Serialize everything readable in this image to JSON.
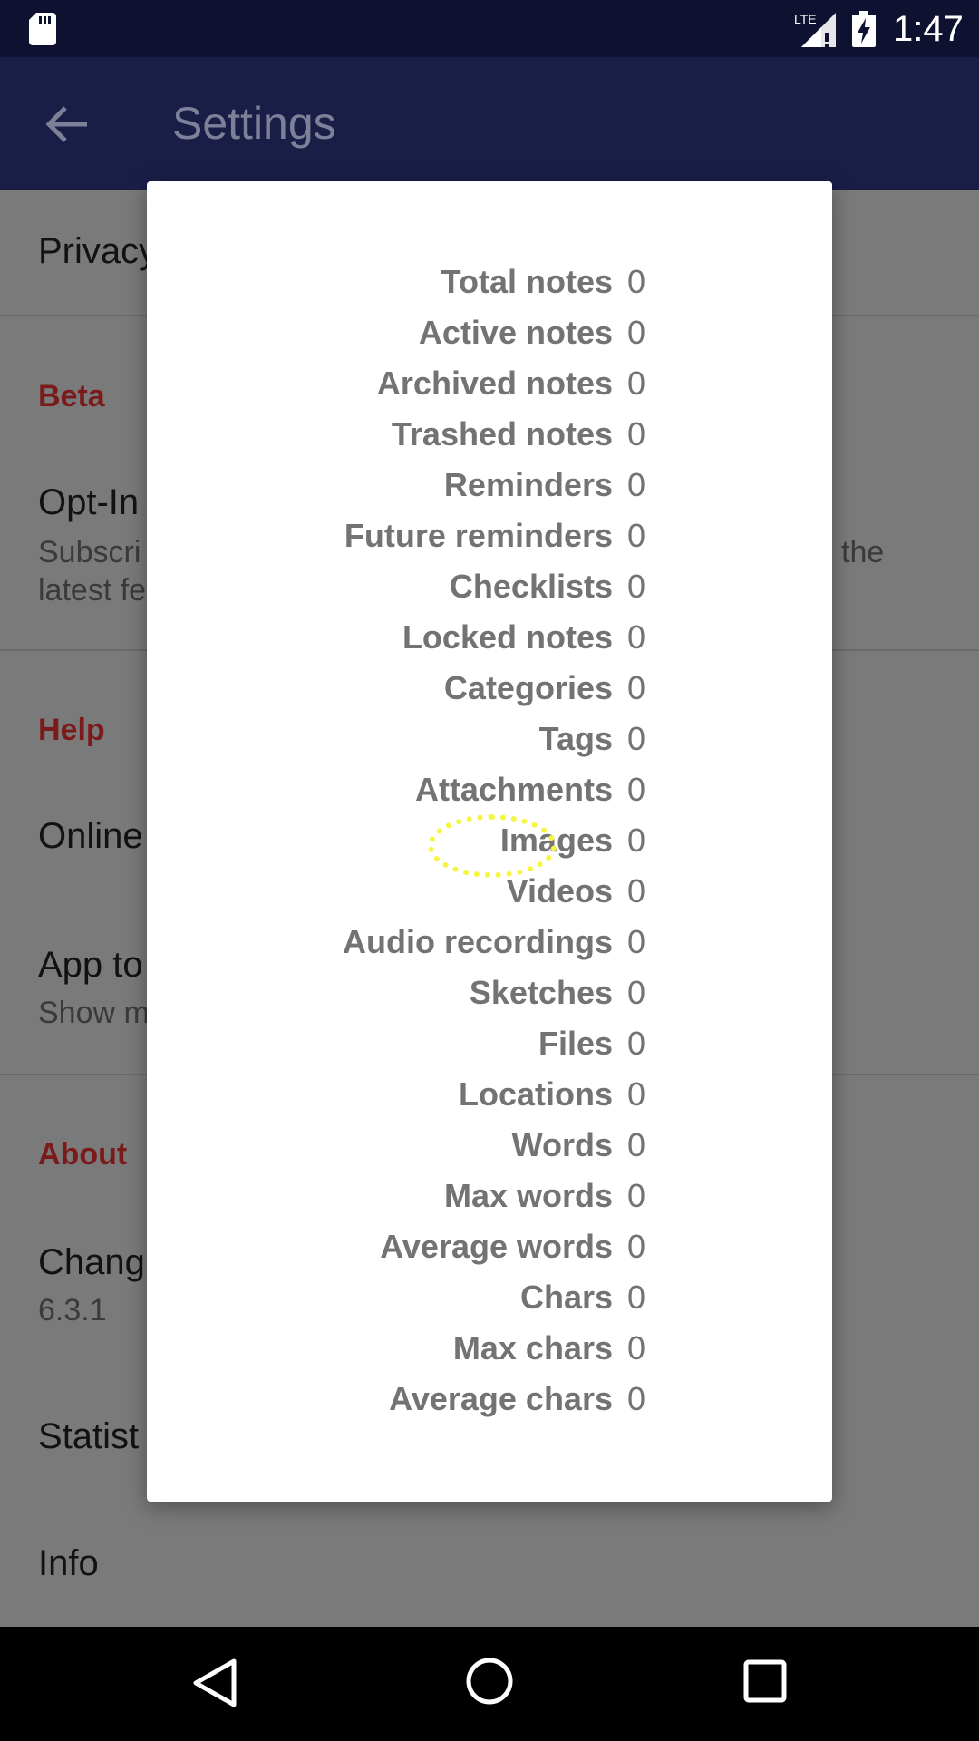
{
  "status_bar": {
    "time": "1:47",
    "network_label": "LTE",
    "icons": [
      "sd-card-icon",
      "lte-signal-icon",
      "battery-charging-icon"
    ]
  },
  "app_bar": {
    "title": "Settings",
    "back_icon": "arrow-left-icon"
  },
  "settings": {
    "privacy": "Privacy",
    "beta_header": "Beta",
    "optin_title": "Opt-In",
    "optin_summary_line1": "Subscri",
    "optin_summary_tail": "the",
    "optin_summary_line2": "latest fe",
    "help_header": "Help",
    "online": "Online",
    "app_tour": "App to",
    "app_tour_summary": "Show m",
    "about_header": "About",
    "changelog": "Chang",
    "version": "6.3.1",
    "statistics": "Statist",
    "info": "Info"
  },
  "colors": {
    "section_header": "#7a1a1a",
    "app_bar": "#1a1e47",
    "highlight": "#f5f542"
  },
  "dialog": {
    "stats": [
      {
        "label": "Total notes",
        "value": "0"
      },
      {
        "label": "Active notes",
        "value": "0"
      },
      {
        "label": "Archived notes",
        "value": "0"
      },
      {
        "label": "Trashed notes",
        "value": "0"
      },
      {
        "label": "Reminders",
        "value": "0"
      },
      {
        "label": "Future reminders",
        "value": "0"
      },
      {
        "label": "Checklists",
        "value": "0"
      },
      {
        "label": "Locked notes",
        "value": "0"
      },
      {
        "label": "Categories",
        "value": "0"
      },
      {
        "label": "Tags",
        "value": "0"
      },
      {
        "label": "Attachments",
        "value": "0"
      },
      {
        "label": "Images",
        "value": "0"
      },
      {
        "label": "Videos",
        "value": "0"
      },
      {
        "label": "Audio recordings",
        "value": "0"
      },
      {
        "label": "Sketches",
        "value": "0"
      },
      {
        "label": "Files",
        "value": "0"
      },
      {
        "label": "Locations",
        "value": "0"
      },
      {
        "label": "Words",
        "value": "0"
      },
      {
        "label": "Max words",
        "value": "0"
      },
      {
        "label": "Average words",
        "value": "0"
      },
      {
        "label": "Chars",
        "value": "0"
      },
      {
        "label": "Max chars",
        "value": "0"
      },
      {
        "label": "Average chars",
        "value": "0"
      }
    ]
  },
  "nav_bar": {
    "icons": [
      "nav-back-icon",
      "nav-home-icon",
      "nav-recents-icon"
    ]
  }
}
